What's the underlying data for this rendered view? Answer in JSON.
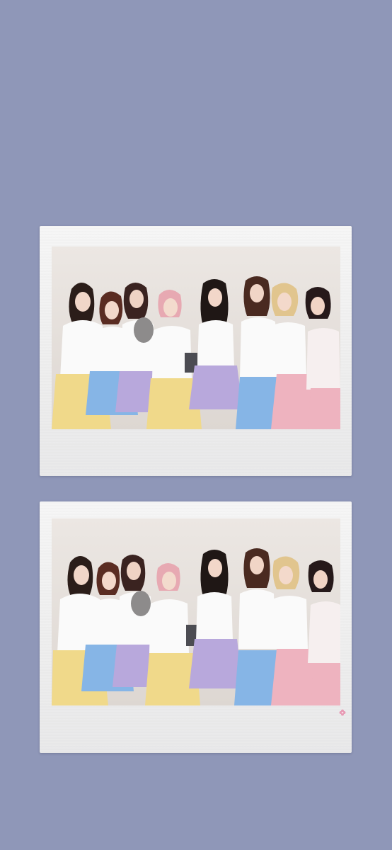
{
  "screen": {
    "background_color": "#8f97b8"
  },
  "polaroids": [
    {
      "photo": {
        "people_count": 8,
        "icon": "group-photo-icon"
      }
    },
    {
      "photo": {
        "people_count": 8,
        "icon": "group-photo-icon"
      },
      "sticker": {
        "icon": "flower-sticker-icon",
        "color": "#e79ab4"
      }
    }
  ],
  "colors": {
    "frame": "#f0f0f0",
    "backdrop": "#e6e1dd",
    "skirt_yellow": "#f0d98a",
    "skirt_blue": "#86b5e6",
    "skirt_lilac": "#b8a8dc",
    "skirt_pink": "#eeb3bf",
    "shirt_white": "#fafafa"
  }
}
